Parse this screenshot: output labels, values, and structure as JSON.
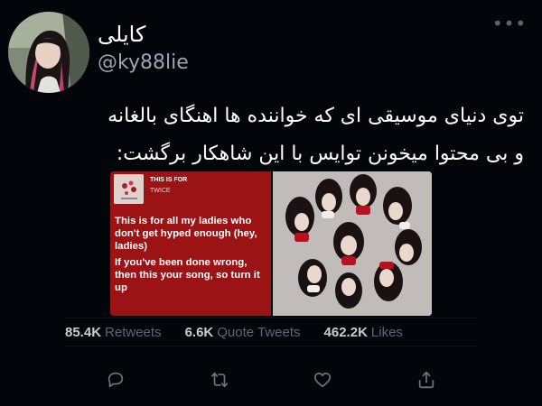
{
  "tweet": {
    "display_name": "کایلی",
    "handle": "@ky88lie",
    "more_icon": "more-horizontal-icon",
    "text_lines": [
      "توی دنیای موسیقی ای که خواننده ها اهنگای بالغانه",
      "و بی محتوا میخونن توایس با این شاهکار برگشت:"
    ]
  },
  "media": {
    "playlist": {
      "kicker": "THIS IS FOR",
      "artist": "TWICE",
      "lyrics": [
        "This is for all my ladies who don't get hyped enough (hey, ladies)",
        "If you've been done wrong, then this your song, so turn it up"
      ],
      "background_color": "#9c1316"
    }
  },
  "stats": {
    "retweets_count": "85.4K",
    "retweets_label": "Retweets",
    "quote_count": "6.6K",
    "quote_label": "Quote Tweets",
    "likes_count": "462.2K",
    "likes_label": "Likes"
  },
  "actions": {
    "reply_icon": "reply-icon",
    "retweet_icon": "retweet-icon",
    "like_icon": "heart-icon",
    "share_icon": "share-icon"
  }
}
